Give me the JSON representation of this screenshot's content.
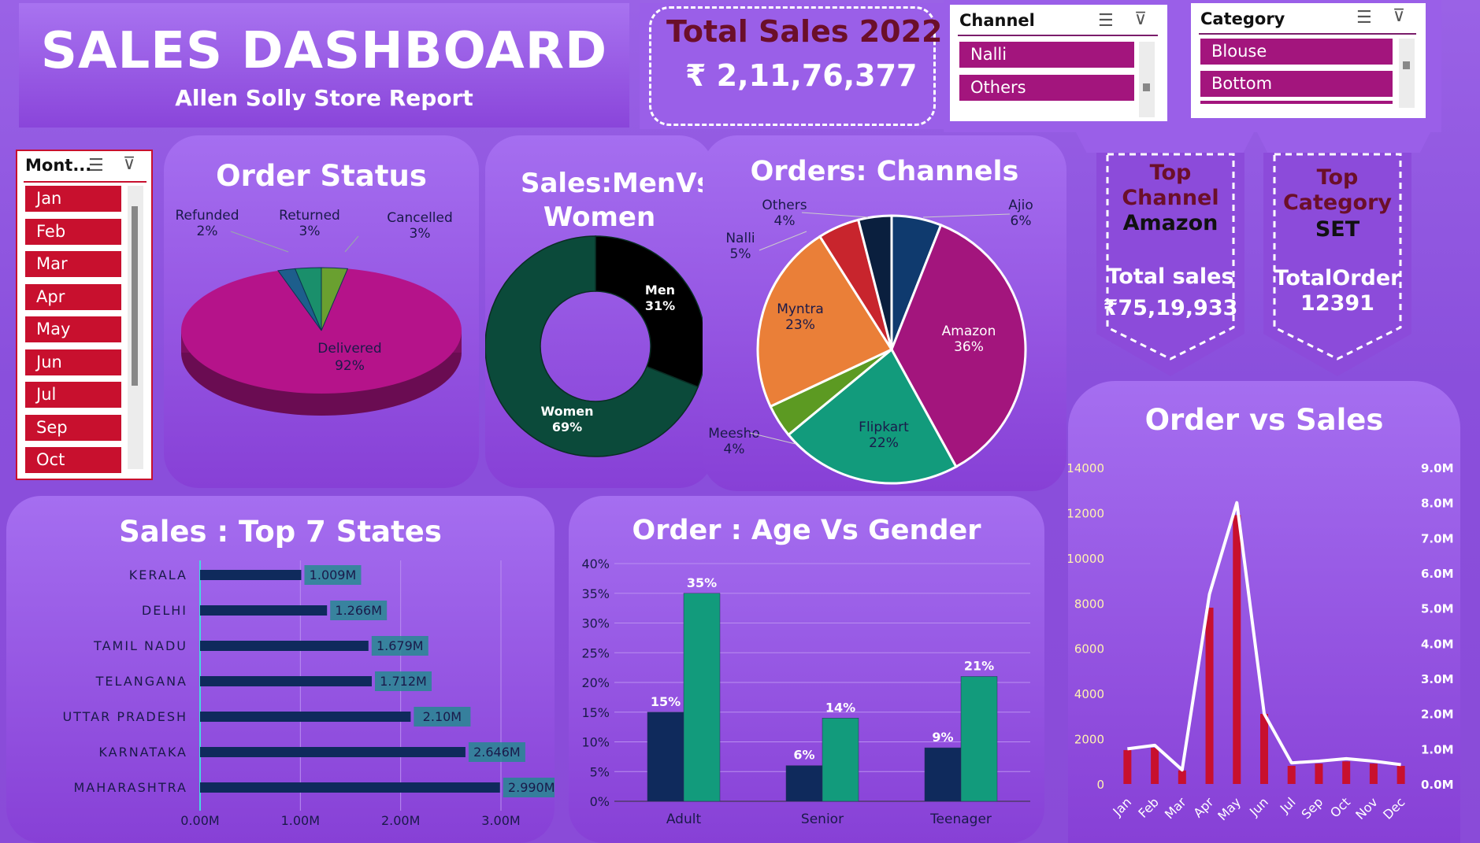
{
  "header": {
    "title": "SALES DASHBOARD",
    "subtitle": "Allen Solly Store Report"
  },
  "total": {
    "label": "Total Sales 2022",
    "value": "₹ 2,11,76,377"
  },
  "channel_slicer": {
    "title": "Channel",
    "items": [
      "Nalli",
      "Others"
    ]
  },
  "category_slicer": {
    "title": "Category",
    "items": [
      "Blouse",
      "Bottom"
    ]
  },
  "month_slicer": {
    "title": "Mont...",
    "items": [
      "Jan",
      "Feb",
      "Mar",
      "Apr",
      "May",
      "Jun",
      "Jul",
      "Sep",
      "Oct"
    ]
  },
  "top_channel": {
    "label1": "Top",
    "label2": "Channel",
    "name": "Amazon",
    "metric_label": "Total sales",
    "metric_value": "₹75,19,933"
  },
  "top_category": {
    "label1": "Top",
    "label2": "Category",
    "name": "SET",
    "metric_label": "TotalOrder",
    "metric_value": "12391"
  },
  "colors": {
    "accent": "#6b0f2a",
    "chip_purple": "#a3157d",
    "chip_red": "#c8102e",
    "navy": "#0f2a5c",
    "teal": "#129b7c"
  },
  "chart_data": [
    {
      "type": "pie",
      "title": "Order Status",
      "categories": [
        "Delivered",
        "Refunded",
        "Returned",
        "Cancelled"
      ],
      "values": [
        92,
        2,
        3,
        3
      ],
      "labels": [
        "92%",
        "2%",
        "3%",
        "3%"
      ],
      "colors": [
        "#b5138a",
        "#1d5e8c",
        "#1a8f6b",
        "#6aa030"
      ]
    },
    {
      "type": "pie",
      "title": "Sales:MenVs Women",
      "categories": [
        "Men",
        "Women"
      ],
      "values": [
        31,
        69
      ],
      "labels": [
        "31%",
        "69%"
      ],
      "colors": [
        "#000000",
        "#0b4a3a"
      ]
    },
    {
      "type": "pie",
      "title": "Orders: Channels",
      "categories": [
        "Amazon",
        "Flipkart",
        "Meesho",
        "Myntra",
        "Nalli",
        "Others",
        "Ajio"
      ],
      "values": [
        36,
        22,
        4,
        23,
        5,
        4,
        6
      ],
      "labels": [
        "36%",
        "22%",
        "4%",
        "23%",
        "5%",
        "4%",
        "6%"
      ],
      "colors": [
        "#a3157d",
        "#129b7c",
        "#5c9a22",
        "#ea7f38",
        "#c8252d",
        "#0a1f3e",
        "#0f3a6e"
      ]
    },
    {
      "type": "bar",
      "title": "Sales : Top 7 States",
      "categories": [
        "KERALA",
        "DELHI",
        "TAMIL NADU",
        "TELANGANA",
        "UTTAR PRADESH",
        "KARNATAKA",
        "MAHARASHTRA"
      ],
      "values": [
        1.009,
        1.266,
        1.679,
        1.712,
        2.1,
        2.646,
        2.99
      ],
      "labels": [
        "1.009M",
        "1.266M",
        "1.679M",
        "1.712M",
        "2.10M",
        "2.646M",
        "2.990M"
      ],
      "xticks": [
        "0.00M",
        "1.00M",
        "2.00M",
        "3.00M"
      ],
      "xlim": [
        0,
        3
      ]
    },
    {
      "type": "bar",
      "title": "Order : Age Vs Gender",
      "categories": [
        "Adult",
        "Senior",
        "Teenager"
      ],
      "series": [
        {
          "values": [
            15,
            6,
            9
          ],
          "labels": [
            "15%",
            "6%",
            "9%"
          ]
        },
        {
          "values": [
            35,
            14,
            21
          ],
          "labels": [
            "35%",
            "14%",
            "21%"
          ]
        }
      ],
      "yticks": [
        "0%",
        "5%",
        "10%",
        "15%",
        "20%",
        "25%",
        "30%",
        "35%",
        "40%"
      ],
      "ylim": [
        0,
        40
      ]
    },
    {
      "type": "bar",
      "title": "Order vs Sales",
      "categories": [
        "Jan",
        "Feb",
        "Mar",
        "Apr",
        "May",
        "Jun",
        "Jul",
        "Sep",
        "Oct",
        "Nov",
        "Dec"
      ],
      "series": [
        {
          "type": "bar",
          "values": [
            1500,
            1600,
            600,
            7800,
            11900,
            3100,
            800,
            900,
            1000,
            900,
            800
          ]
        },
        {
          "type": "line",
          "values": [
            1.0,
            1.1,
            0.4,
            5.4,
            8.0,
            2.0,
            0.6,
            0.65,
            0.72,
            0.65,
            0.55
          ]
        }
      ],
      "yticks_left": [
        "0",
        "2000",
        "4000",
        "6000",
        "8000",
        "10000",
        "12000",
        "14000"
      ],
      "ylim_left": [
        0,
        14000
      ],
      "yticks_right": [
        "0.0M",
        "1.0M",
        "2.0M",
        "3.0M",
        "4.0M",
        "5.0M",
        "6.0M",
        "7.0M",
        "8.0M",
        "9.0M"
      ],
      "ylim_right": [
        0,
        9
      ]
    }
  ]
}
